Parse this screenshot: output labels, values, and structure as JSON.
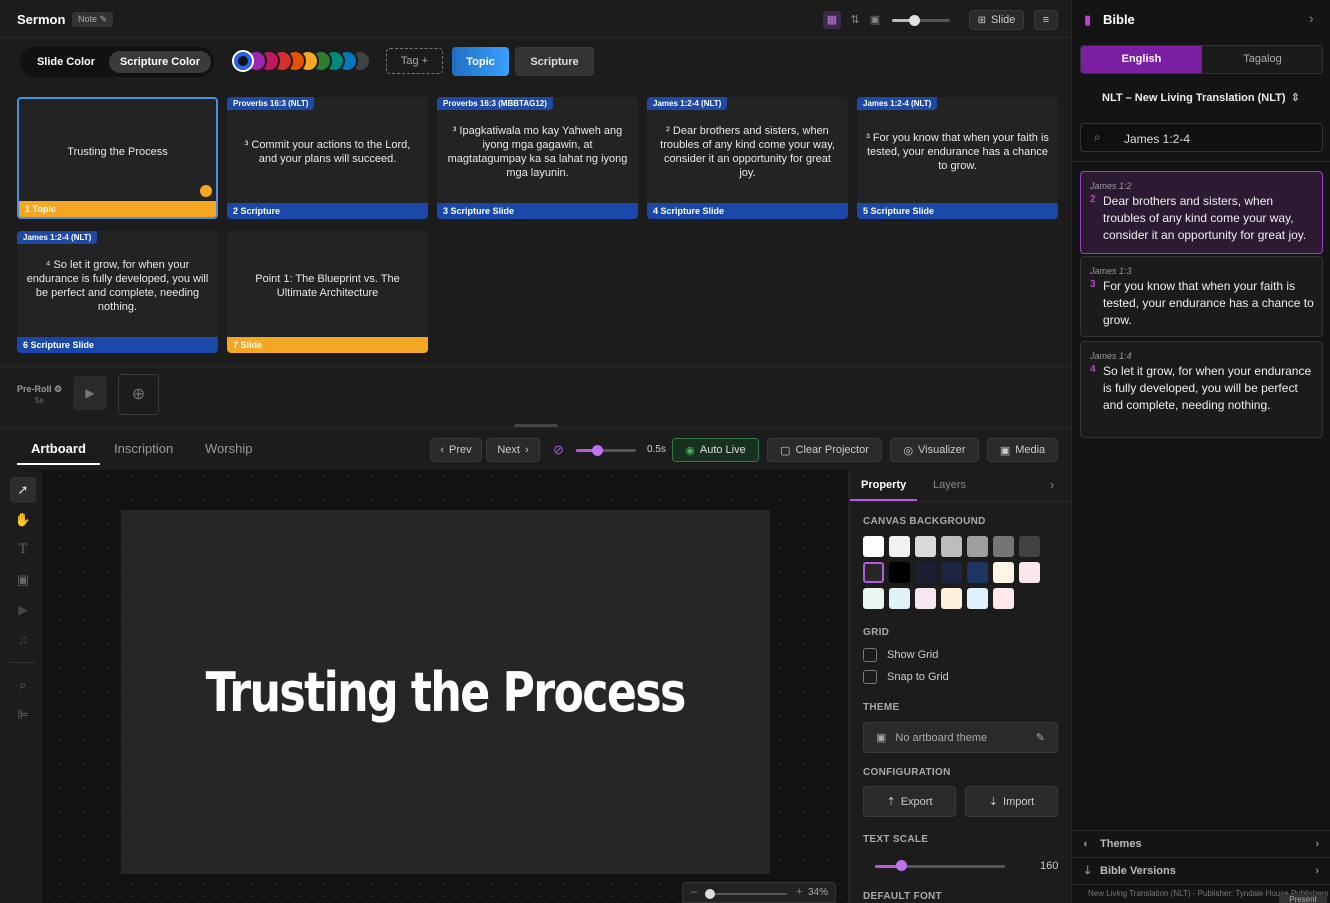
{
  "topbar": {
    "title": "Sermon",
    "note": "Note ✎",
    "slide_button": "Slide"
  },
  "toolbar": {
    "slide_color": "Slide Color",
    "scripture_color": "Scripture Color",
    "tag_button": "Tag +",
    "topic_button": "Topic",
    "scripture_button": "Scripture",
    "palette": [
      "#2563eb",
      "#9c27b0",
      "#c2185b",
      "#d32f2f",
      "#e65100",
      "#f9a825",
      "#2e7d32",
      "#00897b",
      "#0277bd",
      "#424242"
    ]
  },
  "slides": [
    {
      "ref": "",
      "text": "Trusting the Process",
      "footer": "1 Topic",
      "kind": "orange"
    },
    {
      "ref": "Proverbs 16:3 (NLT)",
      "text": "³ Commit your actions to the Lord, and your plans will succeed.",
      "footer": "2 Scripture",
      "kind": "blue"
    },
    {
      "ref": "Proverbs 16:3 (MBBTAG12)",
      "text": "³ Ipagkatiwala mo kay Yahweh ang iyong mga gagawin, at magtatagumpay ka sa lahat ng iyong mga layunin.",
      "footer": "3 Scripture Slide",
      "kind": "blue"
    },
    {
      "ref": "James 1:2-4 (NLT)",
      "text": "² Dear brothers and sisters, when troubles of any kind come your way, consider it an opportunity for great joy.",
      "footer": "4 Scripture Slide",
      "kind": "blue"
    },
    {
      "ref": "James 1:2-4 (NLT)",
      "text": "³ For you know that when your faith is tested, your endurance has a chance to grow.",
      "footer": "5 Scripture Slide",
      "kind": "blue"
    },
    {
      "ref": "James 1:2-4 (NLT)",
      "text": "⁴ So let it grow, for when your endurance is fully developed, you will be perfect and complete, needing nothing.",
      "footer": "6 Scripture Slide",
      "kind": "blue"
    },
    {
      "ref": "",
      "text": "Point 1: The Blueprint vs. The Ultimate Architecture",
      "footer": "7 Slide",
      "kind": "orange"
    }
  ],
  "preroll": {
    "label": "Pre-Roll ⚙",
    "duration": "5s"
  },
  "tabs": {
    "artboard": "Artboard",
    "inscription": "Inscription",
    "worship": "Worship"
  },
  "controls": {
    "prev": "Prev",
    "next": "Next",
    "transition": "0.5s",
    "auto_live": "Auto Live",
    "clear_projector": "Clear Projector",
    "visualizer": "Visualizer",
    "media": "Media",
    "transition_level": 0.35
  },
  "artboard": {
    "text": "Trusting the Process",
    "zoom": "34%",
    "zoom_minus": "–",
    "zoom_plus": "+"
  },
  "properties": {
    "tab_property": "Property",
    "tab_layers": "Layers",
    "canvas_background": "CANVAS BACKGROUND",
    "swatches_row1": [
      "#ffffff",
      "#f2f2f2",
      "#d9d9d9",
      "#bdbdbd",
      "#9e9e9e",
      "#757575",
      "#424242"
    ],
    "swatches_row2": [
      "#262626",
      "#000000",
      "#1a1f33",
      "#1c2540",
      "#1d3560",
      "#fdf6e3",
      "#fde7ec"
    ],
    "swatches_row3": [
      "#e8f5f0",
      "#dff3f9",
      "#f6e6f1",
      "#fdf0dc",
      "#dff2fb",
      "#fde8ec"
    ],
    "grid": "GRID",
    "show_grid": "Show Grid",
    "snap_grid": "Snap to Grid",
    "theme": "THEME",
    "theme_value": "No artboard theme",
    "configuration": "CONFIGURATION",
    "export": "Export",
    "import": "Import",
    "text_scale": "TEXT SCALE",
    "text_scale_value": "160",
    "text_scale_level": 0.2,
    "default_font": "DEFAULT FONT"
  },
  "bible": {
    "title": "Bible",
    "lang_english": "English",
    "lang_tagalog": "Tagalog",
    "translation": "NLT – New Living Translation (NLT)",
    "search": "James 1:2-4",
    "verses": [
      {
        "ref": "James 1:2",
        "num": "2",
        "text": "Dear brothers and sisters, when troubles of any kind come your way, consider it an opportunity for great joy."
      },
      {
        "ref": "James 1:3",
        "num": "3",
        "text": "For you know that when your faith is tested, your endurance has a chance to grow."
      },
      {
        "ref": "James 1:4",
        "num": "4",
        "text": "So let it grow, for when your endurance is fully developed, you will be perfect and complete, needing nothing."
      }
    ],
    "themes": "Themes",
    "versions": "Bible Versions",
    "footer": "New Living Translation (NLT) - Publisher: Tyndale House Publishers",
    "footer_btn": "Present"
  }
}
